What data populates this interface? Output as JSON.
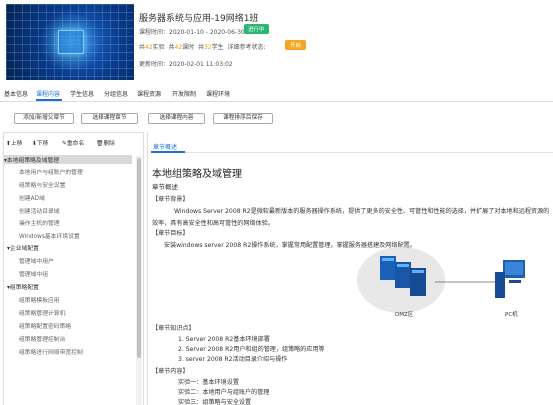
{
  "course": {
    "title": "服务器系统与应用-19网络1班",
    "period": "课程时间：2020-01-10 - 2020-06-30",
    "status": "进行中",
    "stats": {
      "exp_num": "42",
      "exp_label": "实验",
      "class_num": "42",
      "class_label": "课时",
      "stu_num": "32",
      "stu_label": "学生",
      "eval": "详细参考状态:"
    },
    "open_badge": "开启",
    "updated": "更新时间：2020-02-01 11:03:02"
  },
  "tabs": [
    "基本信息",
    "课程内容",
    "学生信息",
    "分组信息",
    "课程资源",
    "开发限制",
    "课程环境"
  ],
  "buttons": [
    "添加/新增父章节",
    "选择课程章节",
    "选择课程内容",
    "课程排序后保存"
  ],
  "toolbar": {
    "up": "上移",
    "down": "下移",
    "rename": "重命名",
    "delete": "删除"
  },
  "tree": [
    {
      "label": "本地组策略及域管理",
      "type": "group"
    },
    {
      "label": "本地用户与组账户的管理",
      "type": "sub"
    },
    {
      "label": "组策略与安全设置",
      "type": "sub"
    },
    {
      "label": "创建AD域",
      "type": "sub"
    },
    {
      "label": "创建活动目录域",
      "type": "sub"
    },
    {
      "label": "操作主机的管理",
      "type": "sub"
    },
    {
      "label": "Windows基本环境设置",
      "type": "sub"
    },
    {
      "label": "企业域配置",
      "type": "group"
    },
    {
      "label": "管理域中用户",
      "type": "sub"
    },
    {
      "label": "管理域中组",
      "type": "sub"
    },
    {
      "label": "组策略配置",
      "type": "group"
    },
    {
      "label": "组策略模板应用",
      "type": "sub"
    },
    {
      "label": "组策略管理计算机",
      "type": "sub"
    },
    {
      "label": "组策略配置密码策略",
      "type": "sub"
    },
    {
      "label": "组策略管理控制台",
      "type": "sub"
    },
    {
      "label": "组策略进行网络带宽控制",
      "type": "sub"
    }
  ],
  "content": {
    "tab": "章节概述",
    "title": "本地组策略及域管理",
    "subtitle": "章节概述",
    "bg_label": "【章节背景】",
    "bg_text1": "Windows Server 2008 R2是微软最新版本的服务器操作系统，提供了更多的安全性、可管性和性能的选择，并扩展了对本地和远程资源的",
    "bg_text2": "效率，具有高安全性和高可管性的网络体验。",
    "goal_label": "【章节目标】",
    "goal_text": "安装windows server 2008 R2操作系统，掌握常用配置管理，掌握服务器搭建及网络配置。",
    "dmz": "DMZ区",
    "pc": "PC机",
    "knowledge_label": "【章节知识点】",
    "knowledge": [
      "1.    Server 2008 R2基本环境部署",
      "2.    Server 2008 R2用户和组的管理，组策略的应用等",
      "3.    server 2008 R2活动目录介绍与操作"
    ],
    "content_label": "【章节内容】",
    "items": [
      "实验一：基本环境设置",
      "实验二：本地用户与组账户的管理",
      "实验三：组策略与安全设置"
    ]
  }
}
